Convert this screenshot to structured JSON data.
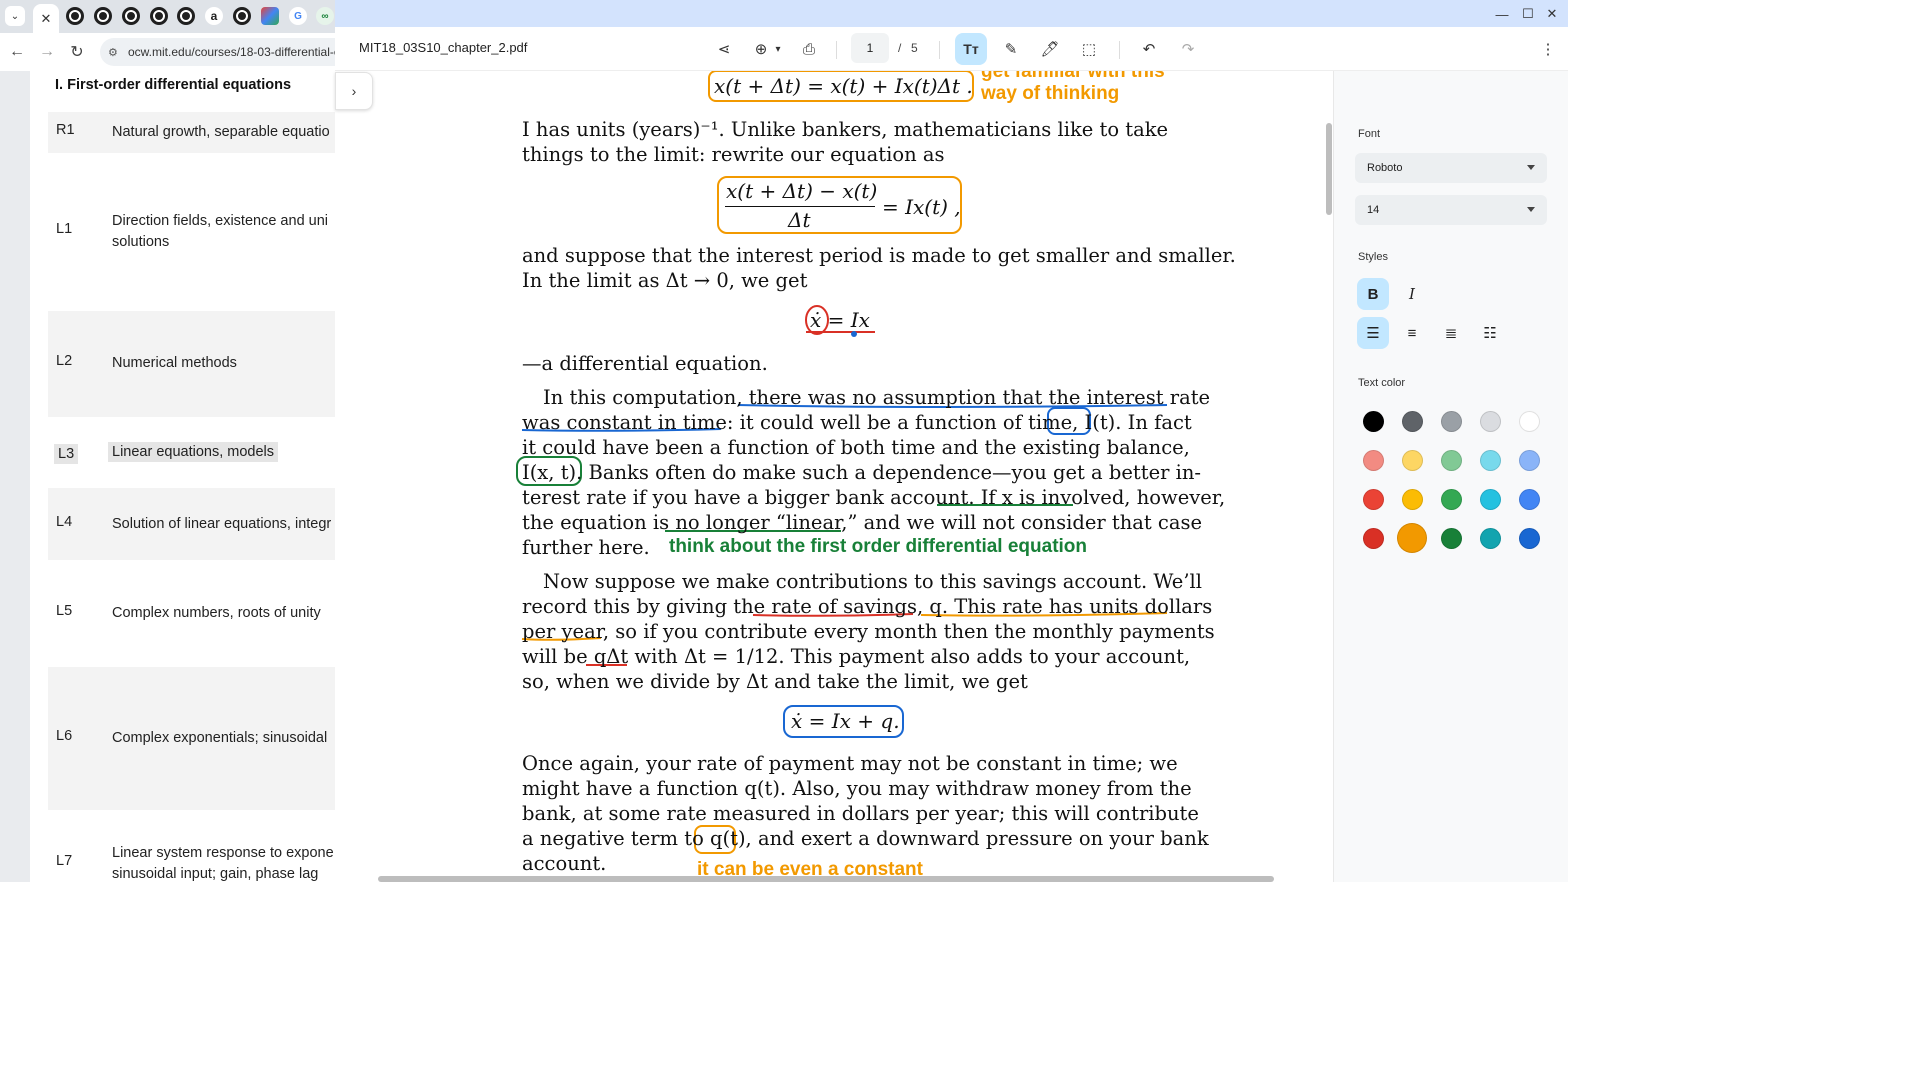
{
  "browser": {
    "tab_close_glyph": "✕",
    "url": "ocw.mit.edu/courses/18-03-differential-e",
    "tab_icons": [
      "mit-icon",
      "mit-icon",
      "mit-icon",
      "mit-icon",
      "mit-icon",
      "amazon-icon",
      "mit-icon",
      "app-icon",
      "google-icon",
      "link-icon"
    ]
  },
  "left_page": {
    "section_title": "I. First-order differential equations",
    "rows": [
      {
        "code": "R1",
        "title": "Natural growth, separable equatio"
      },
      {
        "code": "L1",
        "title": "Direction fields, existence and uni solutions"
      },
      {
        "code": "L2",
        "title": "Numerical methods"
      },
      {
        "code": "L3",
        "title": "Linear equations, models"
      },
      {
        "code": "L4",
        "title": "Solution of linear equations, integr"
      },
      {
        "code": "L5",
        "title": "Complex numbers, roots of unity"
      },
      {
        "code": "L6",
        "title": "Complex exponentials; sinusoidal"
      },
      {
        "code": "L7",
        "title": "Linear system response to expone sinusoidal input; gain, phase lag"
      }
    ]
  },
  "pdf": {
    "filename": "MIT18_03S10_chapter_2.pdf",
    "page_current": "1",
    "page_sep": "/",
    "page_total": "5",
    "lines": {
      "eq_top": "x(t + Δt) = x(t) + Ix(t)Δt .",
      "p1a": "I has units (years)⁻¹.  Unlike bankers, mathematicians like to take",
      "p1b": "things to the limit: rewrite our equation as",
      "eq2_num": "x(t + Δt) − x(t)",
      "eq2_den": "Δt",
      "eq2_rhs": "= Ix(t) ,",
      "p2a": "and suppose that the interest period is made to get smaller and smaller.",
      "p2b": "In the limit as Δt → 0, we get",
      "eq3": "ẋ = Ix",
      "p3": "—a differential equation.",
      "p4a": "In this computation, there was no assumption that the interest rate",
      "p4b": "was constant in time: it could well be a function of time, I(t). In fact",
      "p4c": "it could have been a function of both time and the existing balance,",
      "p4d": "I(x, t). Banks often do make such a dependence—you get a better in-",
      "p4e": "terest rate if you have a bigger bank account. If x is involved, however,",
      "p4f": "the equation is no longer “linear,” and we will not consider that case",
      "p4g": "further here.",
      "p5a": "Now suppose we make contributions to this savings account.  We’ll",
      "p5b": "record this by giving the rate of savings, q. This rate has units dollars",
      "p5c": "per year, so if you contribute every month then the monthly payments",
      "p5d": "will be qΔt with Δt = 1/12. This payment also adds to your account,",
      "p5e": "so, when we divide by Δt and take the limit, we get",
      "eq4": "ẋ = Ix + q.",
      "p6a": "Once again, your rate of payment may not be constant in time; we",
      "p6b": "might have a function q(t). Also, you may withdraw money from the",
      "p6c": "bank, at some rate measured in dollars per year; this will contribute",
      "p6d": "a negative term to q(t), and exert a downward pressure on your bank",
      "p6e": "account."
    },
    "notes": {
      "note1a": "get familiar with this",
      "note1b": "way of thinking",
      "note2": "think about the first order differential equation",
      "note3": "it can be even a constant"
    }
  },
  "panel": {
    "font_label": "Font",
    "font_value": "Roboto",
    "size_value": "14",
    "styles_label": "Styles",
    "bold": "B",
    "italic": "I",
    "color_label": "Text color",
    "colors": [
      [
        "#000000",
        "#5f6368",
        "#9aa0a6",
        "#dadce0",
        "#ffffff"
      ],
      [
        "#f28b82",
        "#fdd663",
        "#81c995",
        "#78d9ec",
        "#8ab4f8"
      ],
      [
        "#ea4335",
        "#fbbc04",
        "#34a853",
        "#24c1e0",
        "#4285f4"
      ],
      [
        "#d93025",
        "#f29900",
        "#188038",
        "#12a4af",
        "#1967d2"
      ]
    ],
    "selected_color": "#f29900"
  },
  "colors": {
    "annot_orange": "#f29900",
    "annot_red": "#d93025",
    "annot_blue": "#1967d2",
    "annot_green": "#188038",
    "accent": "#c2e7ff"
  }
}
